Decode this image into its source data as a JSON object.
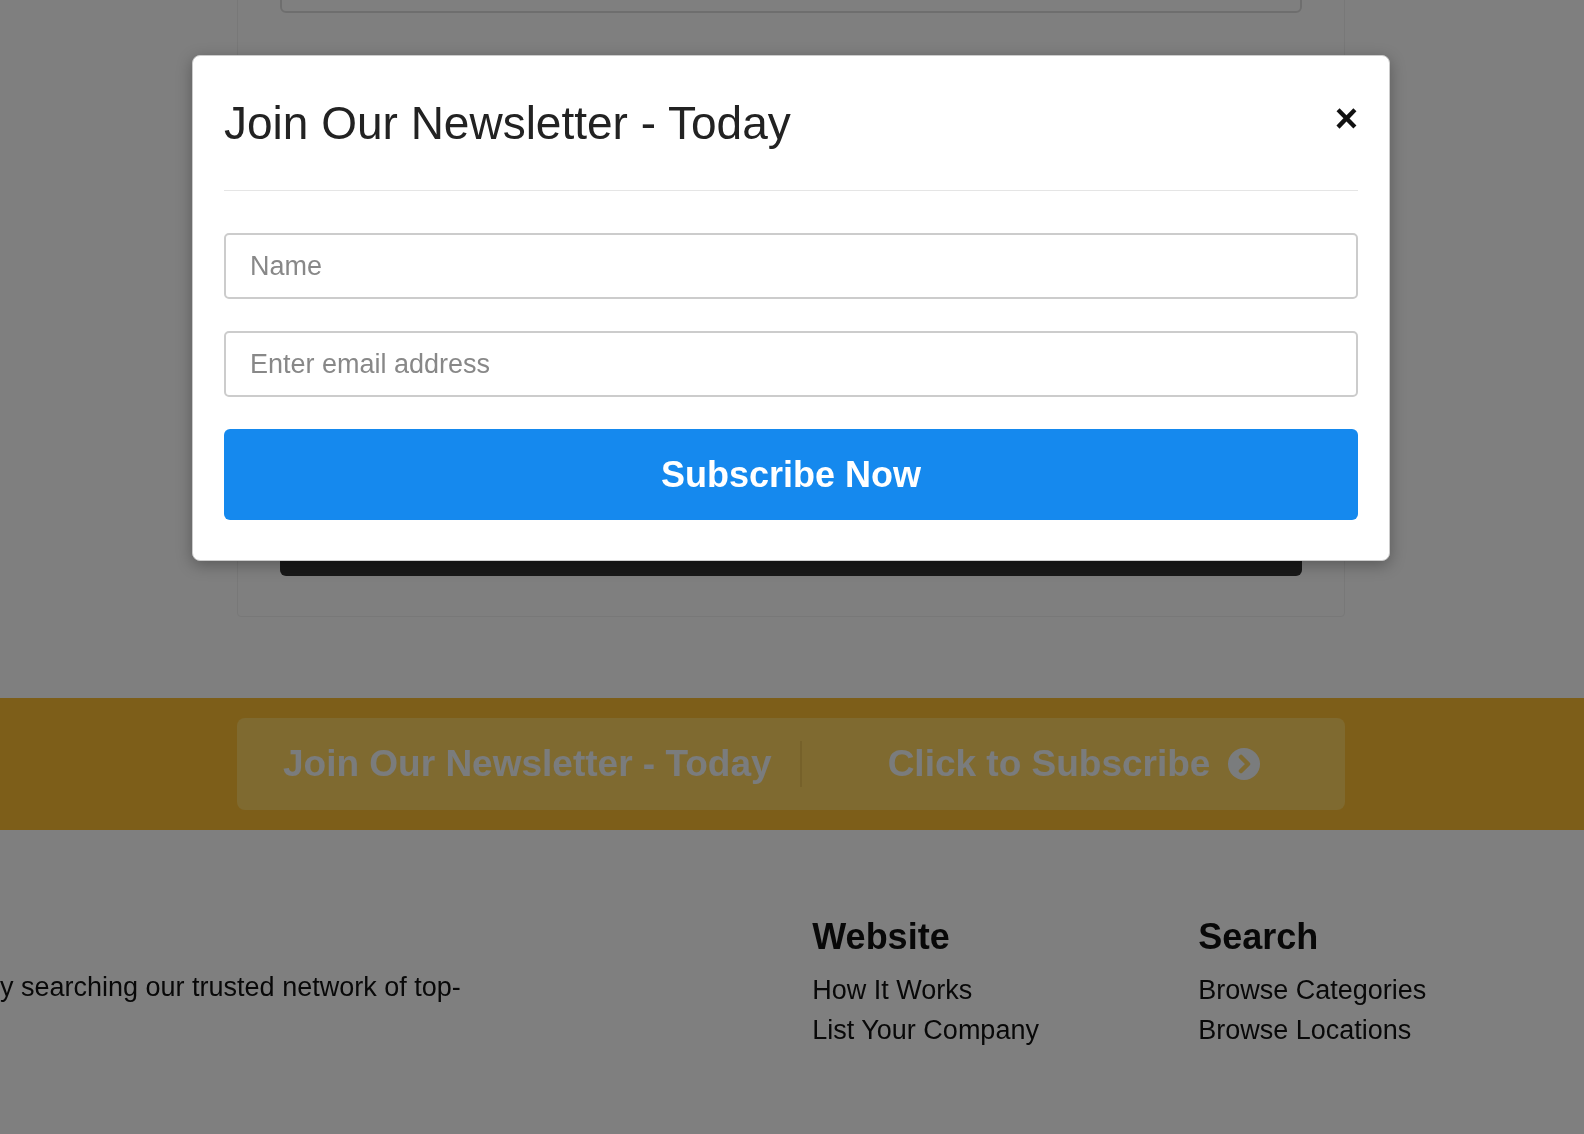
{
  "modal": {
    "title": "Join Our Newsletter - Today",
    "close": "×",
    "fields": [
      {
        "placeholder": "Name"
      },
      {
        "placeholder": "Enter email address"
      }
    ],
    "button": "Subscribe Now"
  },
  "banner": {
    "title": "Join Our Newsletter - Today",
    "link": "Click to Subscribe"
  },
  "footer": {
    "about": "y searching our trusted network of top-",
    "columns": [
      {
        "heading": "Website",
        "links": [
          "How It Works",
          "List Your Company"
        ]
      },
      {
        "heading": "Search",
        "links": [
          "Browse Categories",
          "Browse Locations"
        ]
      }
    ]
  }
}
